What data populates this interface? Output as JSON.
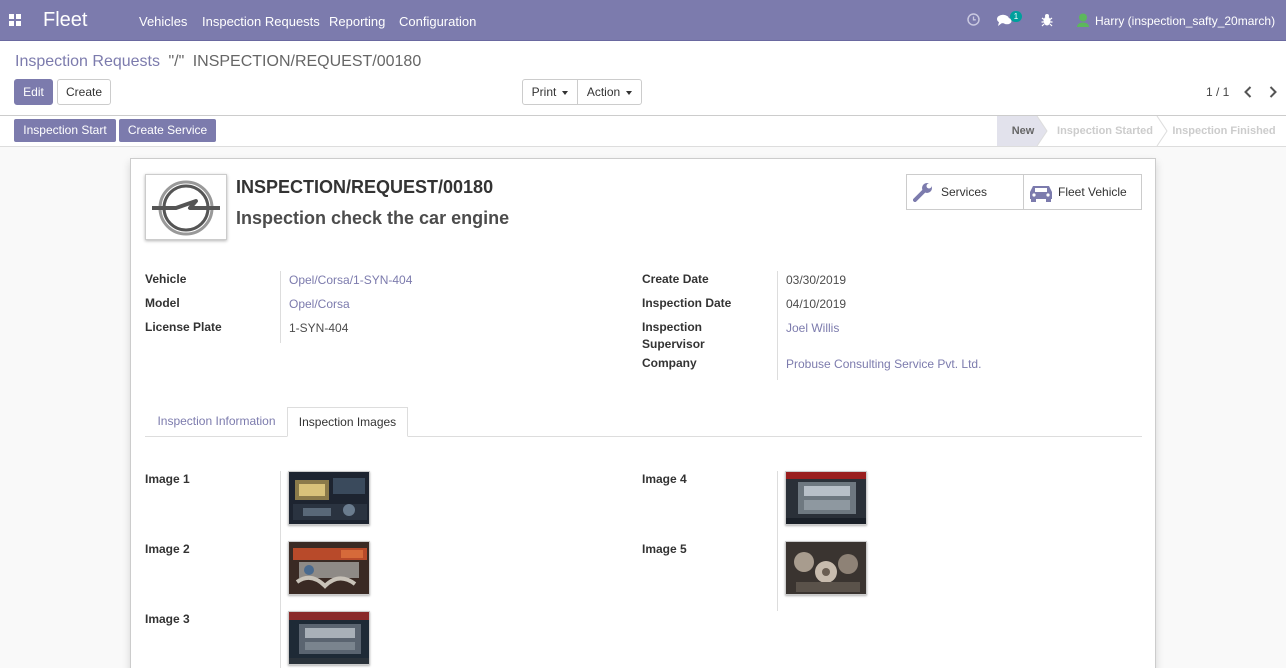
{
  "navbar": {
    "brand": "Fleet",
    "menu": [
      "Vehicles",
      "Inspection Requests",
      "Reporting",
      "Configuration"
    ],
    "chat_count": "1",
    "user": "Harry (inspection_safty_20march)"
  },
  "breadcrumb": {
    "parent": "Inspection Requests",
    "separator": "\"/\"",
    "current": "INSPECTION/REQUEST/00180"
  },
  "buttons": {
    "edit": "Edit",
    "create": "Create",
    "print": "Print",
    "action": "Action"
  },
  "pager": {
    "value": "1 / 1"
  },
  "statusbar": {
    "actions": [
      "Inspection Start",
      "Create Service"
    ],
    "stages": [
      "New",
      "Inspection Started",
      "Inspection Finished"
    ],
    "current_stage": "New"
  },
  "record": {
    "reference": "INSPECTION/REQUEST/00180",
    "name": "Inspection check the car engine",
    "smart_buttons": {
      "services": "Services",
      "fleet_vehicle": "Fleet Vehicle"
    },
    "left_fields": [
      {
        "label": "Vehicle",
        "value": "Opel/Corsa/1-SYN-404"
      },
      {
        "label": "Model",
        "value": "Opel/Corsa"
      },
      {
        "label": "License Plate",
        "value": "1-SYN-404"
      }
    ],
    "right_fields": [
      {
        "label": "Create Date",
        "value": "03/30/2019"
      },
      {
        "label": "Inspection Date",
        "value": "04/10/2019"
      },
      {
        "label": "Inspection Supervisor",
        "value": "Joel Willis"
      },
      {
        "label": "Company",
        "value": "Probuse Consulting Service Pvt. Ltd."
      }
    ]
  },
  "tabs": [
    "Inspection Information",
    "Inspection Images"
  ],
  "active_tab": "Inspection Images",
  "images": {
    "left": [
      "Image 1",
      "Image 2",
      "Image 3"
    ],
    "right": [
      "Image 4",
      "Image 5"
    ]
  },
  "colors": {
    "brand": "#7c7bad",
    "link": "#7c7bad"
  }
}
